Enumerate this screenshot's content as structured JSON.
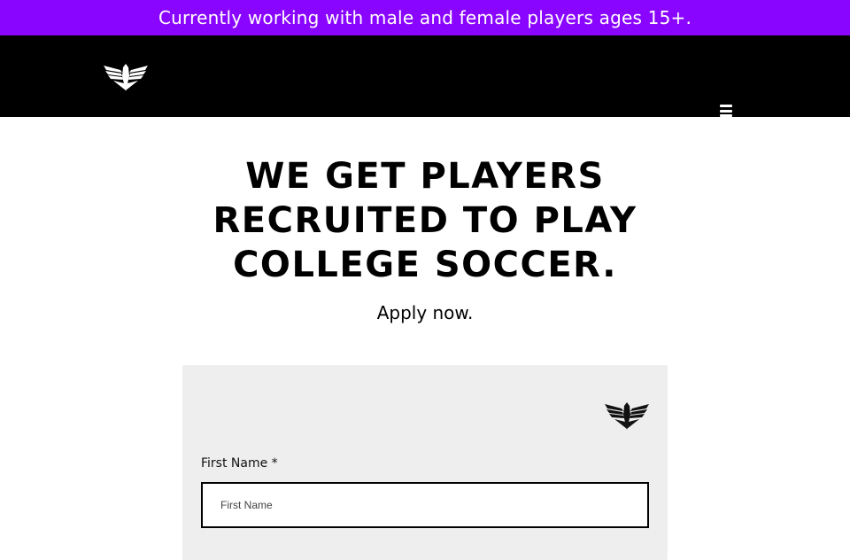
{
  "announcement": {
    "text": "Currently working with male and female players ages 15+."
  },
  "header": {
    "logo_icon": "eagle-logo-icon",
    "menu_icon": "hamburger-menu-icon"
  },
  "hero": {
    "headline": "WE GET PLAYERS RECRUITED TO PLAY COLLEGE SOCCER.",
    "subheadline": "Apply now."
  },
  "form": {
    "logo_icon": "eagle-logo-icon",
    "first_name": {
      "label": "First Name *",
      "placeholder": "First Name",
      "value": ""
    }
  },
  "colors": {
    "announcement_bg": "#8a05ff",
    "header_bg": "#000000",
    "form_bg": "#eeeeee"
  }
}
